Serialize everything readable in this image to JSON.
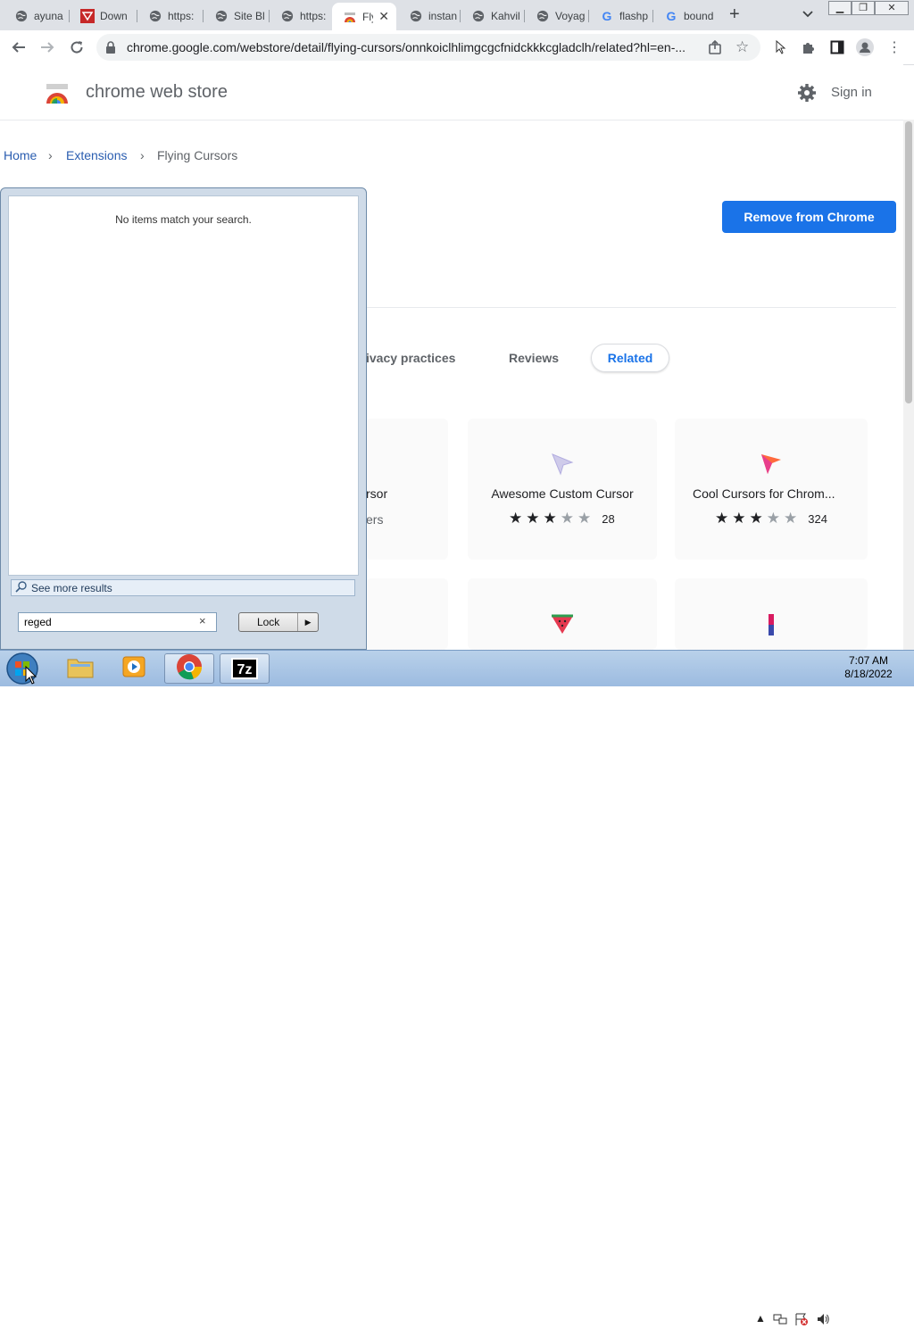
{
  "browser": {
    "tabs": [
      {
        "title": "ayuna",
        "icon": "globe-icon"
      },
      {
        "title": "Down",
        "icon": "red-site-icon"
      },
      {
        "title": "https:",
        "icon": "globe-icon"
      },
      {
        "title": "Site Bl",
        "icon": "globe-icon"
      },
      {
        "title": "https:",
        "icon": "globe-icon"
      },
      {
        "title": "Fly",
        "icon": "webstore-icon",
        "active": true
      },
      {
        "title": "instan",
        "icon": "globe-icon"
      },
      {
        "title": "Kahvil",
        "icon": "globe-icon"
      },
      {
        "title": "Voyag",
        "icon": "globe-icon"
      },
      {
        "title": "flashp",
        "icon": "google-icon"
      },
      {
        "title": "bound",
        "icon": "google-icon"
      }
    ],
    "new_tab_symbol": "+",
    "tab_close_symbol": "✕",
    "url": "chrome.google.com/webstore/detail/flying-cursors/onnkoiclhlimgcgcfnidckkkcgladclh/related?hl=en-..."
  },
  "store": {
    "title": "chrome web store",
    "sign_in": "Sign in",
    "breadcrumb": [
      "Home",
      "Extensions",
      "Flying Cursors"
    ],
    "remove_button": "Remove from Chrome",
    "tabs": [
      "ivacy practices",
      "Reviews",
      "Related"
    ],
    "cards": [
      {
        "name": "rsor",
        "sub": "ers"
      },
      {
        "name": "Awesome Custom Cursor",
        "rating": 3,
        "count": "28",
        "icon_color": "#c9c6e8"
      },
      {
        "name": "Cool Cursors for Chrom...",
        "rating": 3,
        "count": "324",
        "icon_color": "#ff6a3d"
      }
    ]
  },
  "startmenu": {
    "no_items": "No items match your search.",
    "see_more": "See more results",
    "search_value": "reged",
    "clear_symbol": "×",
    "lock_label": "Lock"
  },
  "taskbar": {
    "time": "7:07 AM",
    "date": "8/18/2022",
    "seven_zip_label": "7z"
  }
}
